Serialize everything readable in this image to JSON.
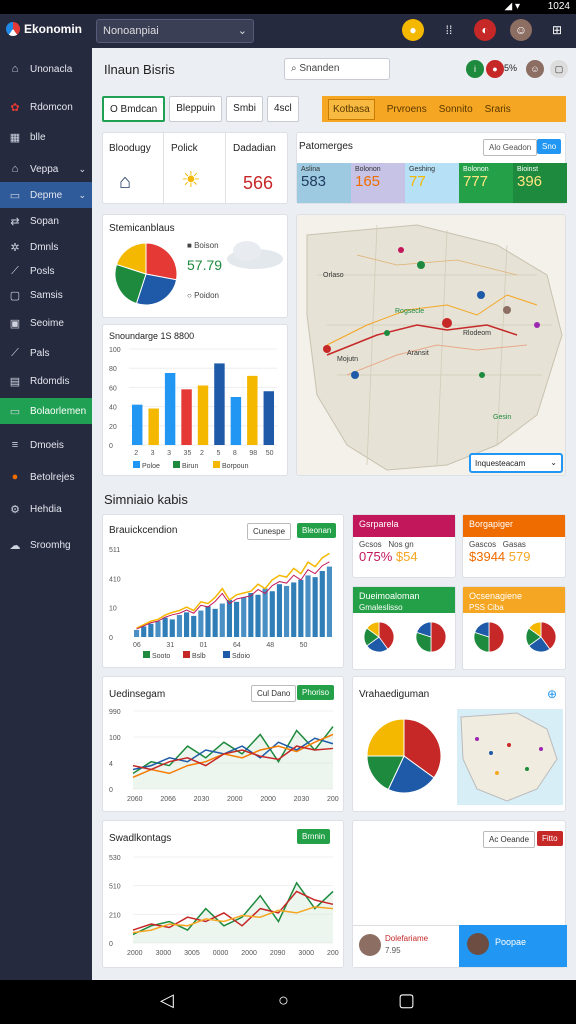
{
  "status": {
    "time": "1024"
  },
  "app": {
    "name": "Ekonomin",
    "workspace": "Nonoanpiai"
  },
  "sidebar": {
    "items": [
      {
        "label": "Unonacla",
        "icon": "home-icon"
      },
      {
        "label": "Rdomcon",
        "icon": "leaf-icon"
      },
      {
        "label": "blle",
        "icon": "grid-icon"
      },
      {
        "label": "Veppa",
        "icon": "home-icon"
      },
      {
        "label": "Depme",
        "icon": "folder-icon"
      },
      {
        "label": "Sopan",
        "icon": "share-icon"
      },
      {
        "label": "Dmnls",
        "icon": "cluster-icon"
      },
      {
        "label": "Posls",
        "icon": "pin-icon"
      },
      {
        "label": "Samsis",
        "icon": "box-icon"
      },
      {
        "label": "Seoime",
        "icon": "calendar-icon"
      },
      {
        "label": "Pals",
        "icon": "pin-icon"
      },
      {
        "label": "Rdomdis",
        "icon": "chart-icon"
      },
      {
        "label": "Bolaorlemen",
        "icon": "folder-icon"
      },
      {
        "label": "Dmoeis",
        "icon": "menu-icon"
      },
      {
        "label": "Betolrejes",
        "icon": "orange-icon"
      },
      {
        "label": "Hehdia",
        "icon": "gear-icon"
      },
      {
        "label": "Sroomhg",
        "icon": "cloud-icon"
      }
    ]
  },
  "header": {
    "title": "Ilnaun Bisris",
    "search_placeholder": "Snanden",
    "badge": "5%"
  },
  "tabs": [
    "O Bmdcan",
    "Bleppuin",
    "Smbi",
    "4scl"
  ],
  "tabs2": [
    "Kotbasa",
    "Prvroens",
    "Sonnito",
    "Sraris"
  ],
  "kpis": [
    {
      "label": "Bloodugy"
    },
    {
      "label": "Polick"
    },
    {
      "label": "Dadadian",
      "value": "566"
    }
  ],
  "ranges": {
    "label": "Patomerges",
    "button": "Alo Geadon",
    "blue_btn": "Sno",
    "cells": [
      {
        "label": "Aslina",
        "value": "583",
        "color": "#9ecae1"
      },
      {
        "label": "Bolonon",
        "value": "165",
        "color": "#c7c3e6"
      },
      {
        "label": "Geshing",
        "value": "77",
        "color": "#b5e0f5"
      },
      {
        "label": "Bolonon",
        "value": "777",
        "color": "#24a148"
      },
      {
        "label": "Bioinst",
        "value": "396",
        "color": "#1d8a3d"
      }
    ]
  },
  "pie_card": {
    "title": "Stemicanblaus",
    "value": "57.79",
    "legend": [
      "Boison",
      "Poidon"
    ],
    "chart_data": {
      "type": "pie",
      "values": [
        28,
        27,
        25,
        20
      ],
      "colors": [
        "#e53935",
        "#1e5aa8",
        "#1d8a3d",
        "#f5b800"
      ]
    }
  },
  "map": {
    "labels": [
      "Orlaso",
      "Mojutn",
      "Aransit",
      "Rogsecle",
      "Rlodeom",
      "Gesin"
    ],
    "dropdown": "Inquesteacam"
  },
  "bar_card": {
    "title": "Snoundarge 1S 8800",
    "legend": [
      "Poloe",
      "Birun",
      "Borpoun"
    ],
    "chart_data": {
      "type": "bar",
      "categories": [
        "2",
        "3",
        "3",
        "35",
        "2",
        "5",
        "8",
        "98",
        "50"
      ],
      "values": [
        42,
        38,
        75,
        58,
        62,
        85,
        50,
        72,
        56
      ],
      "colors": [
        "#2196f3",
        "#f5b800",
        "#2196f3",
        "#e53935",
        "#f5b800",
        "#1e5aa8",
        "#2196f3",
        "#f5b800",
        "#1e5aa8"
      ],
      "ylim": [
        0,
        100
      ],
      "yticks": [
        "100",
        "80",
        "60",
        "40",
        "20",
        "0"
      ]
    }
  },
  "section_title": "Simniaio kabis",
  "trend_card": {
    "title": "Brauickcendion",
    "btn1": "Cunespe",
    "btn2": "Bleonan",
    "yticks": [
      "511",
      "410",
      "10",
      "0"
    ],
    "xticks": [
      "06",
      "31",
      "01",
      "64",
      "48",
      "50"
    ],
    "legend": [
      "Sooto",
      "Bslb",
      "Sdoio"
    ],
    "chart_data": {
      "type": "bar",
      "values": [
        8,
        12,
        15,
        18,
        22,
        20,
        25,
        28,
        24,
        30,
        35,
        32,
        38,
        42,
        40,
        45,
        50,
        48,
        55,
        52,
        60,
        58,
        62,
        65,
        70,
        68,
        75,
        80
      ],
      "line": [
        10,
        14,
        18,
        20,
        25,
        28,
        30,
        34,
        30,
        40,
        38,
        45,
        55,
        42,
        48,
        50,
        52,
        60,
        55,
        65,
        70,
        68,
        78,
        72,
        85,
        80,
        90,
        95
      ]
    }
  },
  "mini_cards": [
    {
      "header": "Gsrparela",
      "color": "#c2185b",
      "sub1": "Gcsos",
      "sub2": "Nos gn",
      "v1": "075%",
      "v2": "$54"
    },
    {
      "header": "Borgapiger",
      "color": "#ef6c00",
      "sub1": "Gascos",
      "sub2": "Gasas",
      "v1": "$3944",
      "v2": "579"
    },
    {
      "header": "Dueimoaloman",
      "color": "#24a148",
      "sub1": "Gmaleslisso",
      "sub2": "",
      "v1": "",
      "v2": ""
    },
    {
      "header": "Ocsenagiene",
      "color": "#f5a623",
      "sub1": "PSS Ciba",
      "sub2": "",
      "v1": "",
      "v2": ""
    }
  ],
  "line_card": {
    "title": "Uedinsegam",
    "btn1": "Cul Dano",
    "btn2": "Phoriso",
    "yticks": [
      "990",
      "100",
      "4",
      "0"
    ],
    "xticks": [
      "2060",
      "2066",
      "2030",
      "2000",
      "2000",
      "2030",
      "2000"
    ],
    "chart_data": {
      "type": "line",
      "series": [
        {
          "color": "#1d8a3d",
          "values": [
            20,
            35,
            30,
            55,
            40,
            60,
            45,
            70,
            35,
            75,
            50,
            80
          ]
        },
        {
          "color": "#1e5aa8",
          "values": [
            25,
            30,
            40,
            35,
            50,
            45,
            55,
            40,
            60,
            50,
            65,
            58
          ]
        },
        {
          "color": "#f57c00",
          "values": [
            15,
            25,
            20,
            30,
            35,
            45,
            40,
            50,
            55,
            48,
            60,
            70
          ]
        },
        {
          "color": "#c62828",
          "values": [
            30,
            25,
            35,
            40,
            30,
            45,
            50,
            42,
            38,
            55,
            50,
            52
          ]
        }
      ]
    }
  },
  "pie_map_card": {
    "title": "Vrahaediguman",
    "chart_data": {
      "type": "pie",
      "values": [
        35,
        22,
        18,
        25
      ],
      "colors": [
        "#c62828",
        "#1e5aa8",
        "#1d8a3d",
        "#f5b800"
      ]
    }
  },
  "area_card": {
    "title": "Swadlkontags",
    "btn": "Brnnin",
    "yticks": [
      "530",
      "510",
      "210",
      "0"
    ],
    "xticks": [
      "2000",
      "3000",
      "3005",
      "0000",
      "2000",
      "2090",
      "3000",
      "2000"
    ],
    "chart_data": {
      "type": "line",
      "series": [
        {
          "color": "#1d8a3d",
          "values": [
            10,
            20,
            25,
            15,
            40,
            20,
            30,
            55,
            25,
            70,
            40,
            60
          ]
        },
        {
          "color": "#c62828",
          "values": [
            15,
            22,
            18,
            30,
            25,
            35,
            20,
            40,
            35,
            60,
            50,
            45
          ]
        },
        {
          "color": "#f5a623",
          "values": [
            12,
            15,
            22,
            20,
            28,
            25,
            32,
            30,
            38,
            35,
            42,
            40
          ]
        }
      ]
    }
  },
  "bottom_right": {
    "btn1": "Ac Oeande",
    "btn2": "Fitto",
    "person1_name": "Dolefariame",
    "person1_sub": "7.95",
    "person2_name": "Poopae"
  }
}
